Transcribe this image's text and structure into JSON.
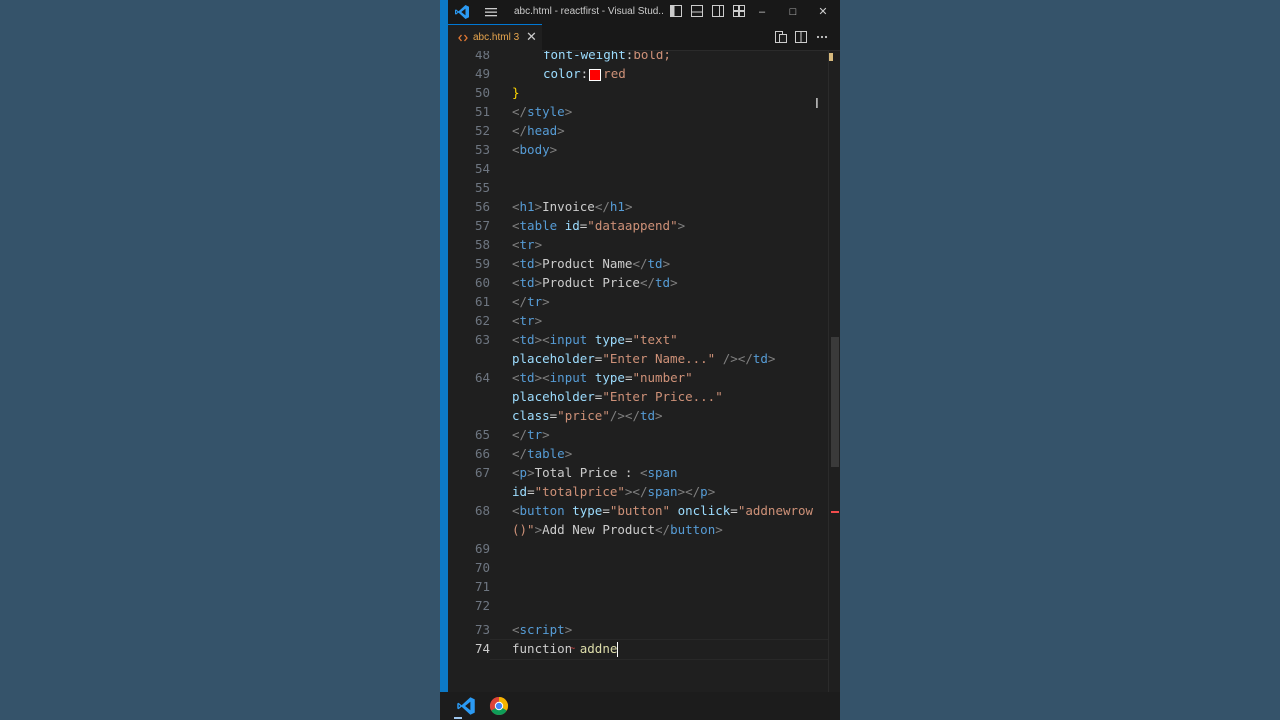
{
  "window": {
    "title": "abc.html - reactfirst - Visual Stud...",
    "logo_icon": "vscode-icon",
    "menu_icon": "hamburger-menu-icon",
    "layout_icons": [
      "toggle-primary-sidebar-icon",
      "toggle-panel-icon",
      "toggle-secondary-sidebar-icon",
      "customize-layout-icon"
    ],
    "controls": {
      "minimize": "–",
      "maximize": "□",
      "close": "✕"
    }
  },
  "tab": {
    "file_icon": "html-file-icon",
    "label": "abc.html 3",
    "close": "✕",
    "actions": [
      "open-changes-icon",
      "split-editor-icon",
      "more-actions-icon"
    ]
  },
  "editor": {
    "active_line": "74",
    "lines": [
      {
        "n": "48"
      },
      {
        "n": "49"
      },
      {
        "n": "50"
      },
      {
        "n": "51"
      },
      {
        "n": "52"
      },
      {
        "n": "53"
      },
      {
        "n": "54"
      },
      {
        "n": "55"
      },
      {
        "n": "56"
      },
      {
        "n": "57"
      },
      {
        "n": "58"
      },
      {
        "n": "59"
      },
      {
        "n": "60"
      },
      {
        "n": "61"
      },
      {
        "n": "62"
      },
      {
        "n": "63"
      },
      {
        "n": "64"
      },
      {
        "n": "65"
      },
      {
        "n": "66"
      },
      {
        "n": "67"
      },
      {
        "n": "68"
      },
      {
        "n": "69"
      },
      {
        "n": "70"
      },
      {
        "n": "71"
      },
      {
        "n": "72"
      },
      {
        "n": "73"
      },
      {
        "n": "74"
      }
    ],
    "tokens": {
      "l48": {
        "prop": "font-weight",
        "colon": ":",
        "val": "bold;"
      },
      "l49": {
        "prop": "color",
        "colon": ":",
        "val": "red"
      },
      "l50": {
        "brace": "}"
      },
      "l51": {
        "open": "</",
        "tag": "style",
        "close": ">"
      },
      "l52": {
        "open": "</",
        "tag": "head",
        "close": ">"
      },
      "l53": {
        "open": "<",
        "tag": "body",
        "close": ">"
      },
      "l56": {
        "a": "<",
        "tag1": "h1",
        "b": ">",
        "text": "Invoice",
        "c": "</",
        "tag2": "h1",
        "d": ">"
      },
      "l57": {
        "a": "<",
        "tag": "table",
        "attr": "id",
        "eq": "=",
        "val": "\"dataappend\"",
        "b": ">"
      },
      "l58": {
        "a": "<",
        "tag": "tr",
        "b": ">"
      },
      "l59": {
        "a": "<",
        "tag1": "td",
        "b": ">",
        "text": "Product Name",
        "c": "</",
        "tag2": "td",
        "d": ">"
      },
      "l60": {
        "a": "<",
        "tag1": "td",
        "b": ">",
        "text": "Product Price",
        "c": "</",
        "tag2": "td",
        "d": ">"
      },
      "l61": {
        "a": "</",
        "tag": "tr",
        "b": ">"
      },
      "l62": {
        "a": "<",
        "tag": "tr",
        "b": ">"
      },
      "l63a": {
        "a": "<",
        "tag1": "td",
        "b": "><",
        "tag2": "input",
        "attr": "type",
        "eq": "=",
        "val": "\"text\""
      },
      "l63b": {
        "attr": "placeholder",
        "eq": "=",
        "val": "\"Enter Name...\"",
        "c": " />",
        "d": "</",
        "tag": "td",
        "e": ">"
      },
      "l64a": {
        "a": "<",
        "tag1": "td",
        "b": "><",
        "tag2": "input",
        "attr": "type",
        "eq": "=",
        "val": "\"number\""
      },
      "l64b": {
        "attr": "placeholder",
        "eq": "=",
        "val": "\"Enter Price...\""
      },
      "l64c": {
        "attr": "class",
        "eq": "=",
        "val": "\"price\"",
        "c": "/>",
        "d": "</",
        "tag": "td",
        "e": ">"
      },
      "l65": {
        "a": "</",
        "tag": "tr",
        "b": ">"
      },
      "l66": {
        "a": "</",
        "tag": "table",
        "b": ">"
      },
      "l67a": {
        "a": "<",
        "tag1": "p",
        "b": ">",
        "text": "Total Price : ",
        "c": "<",
        "tag2": "span"
      },
      "l67b": {
        "attr": "id",
        "eq": "=",
        "val": "\"totalprice\"",
        "c": "></",
        "tag1": "span",
        "d": "></",
        "tag2": "p",
        "e": ">"
      },
      "l68a": {
        "a": "<",
        "tag": "button",
        "attr1": "type",
        "eq1": "=",
        "val1": "\"button\"",
        "attr2": "onclick",
        "eq2": "=",
        "val2": "\"addnewrow"
      },
      "l68b": {
        "val": "()\"",
        "b": ">",
        "text": "Add New Product",
        "c": "</",
        "tag": "button",
        "d": ">"
      },
      "l73": {
        "a": "<",
        "tag": "script",
        "b": ">"
      },
      "l74": {
        "kw": "function",
        "name": "addne"
      }
    },
    "swatch_color": "#ff0000"
  },
  "taskbar": {
    "items": [
      "vscode-taskbar-icon",
      "chrome-taskbar-icon"
    ]
  },
  "colors": {
    "editor_bg": "#1f1f1f",
    "accent": "#0078d4",
    "background": "#355066"
  }
}
